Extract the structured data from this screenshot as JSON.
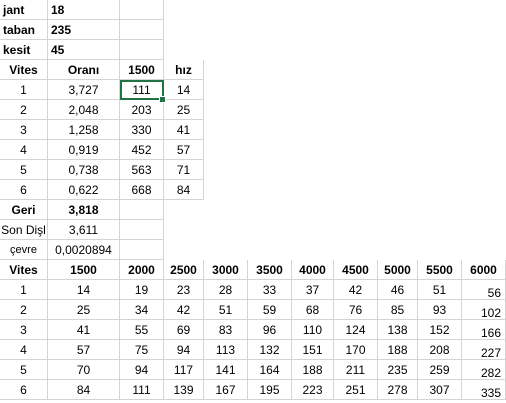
{
  "params": {
    "jant": {
      "label": "jant",
      "value": "18"
    },
    "taban": {
      "label": "taban",
      "value": "235"
    },
    "kesit": {
      "label": "kesit",
      "value": "45"
    }
  },
  "gear_table": {
    "headers": [
      "Vites",
      "Oranı",
      "1500",
      "hız"
    ],
    "rows": [
      [
        "1",
        "3,727",
        "111",
        "14"
      ],
      [
        "2",
        "2,048",
        "203",
        "25"
      ],
      [
        "3",
        "1,258",
        "330",
        "41"
      ],
      [
        "4",
        "0,919",
        "452",
        "57"
      ],
      [
        "5",
        "0,738",
        "563",
        "71"
      ],
      [
        "6",
        "0,622",
        "668",
        "84"
      ]
    ],
    "geri": {
      "label": "Geri",
      "value": "3,818"
    },
    "son_disli": {
      "label": "Son Dişl",
      "value": "3,611"
    },
    "cevre": {
      "label": "çevre",
      "value": "0,0020894"
    }
  },
  "speed_table": {
    "headers": [
      "Vites",
      "1500",
      "2000",
      "2500",
      "3000",
      "3500",
      "4000",
      "4500",
      "5000",
      "5500",
      "6000"
    ],
    "rows": [
      [
        "1",
        "14",
        "19",
        "23",
        "28",
        "33",
        "37",
        "42",
        "46",
        "51",
        "56"
      ],
      [
        "2",
        "25",
        "34",
        "42",
        "51",
        "59",
        "68",
        "76",
        "85",
        "93",
        "102"
      ],
      [
        "3",
        "41",
        "55",
        "69",
        "83",
        "96",
        "110",
        "124",
        "138",
        "152",
        "166"
      ],
      [
        "4",
        "57",
        "75",
        "94",
        "113",
        "132",
        "151",
        "170",
        "188",
        "208",
        "227"
      ],
      [
        "5",
        "70",
        "94",
        "117",
        "141",
        "164",
        "188",
        "211",
        "235",
        "259",
        "282"
      ],
      [
        "6",
        "84",
        "111",
        "139",
        "167",
        "195",
        "223",
        "251",
        "278",
        "307",
        "335"
      ]
    ]
  },
  "selection": {
    "color": "#217346",
    "cell": "1500 gear 1 (111)"
  }
}
